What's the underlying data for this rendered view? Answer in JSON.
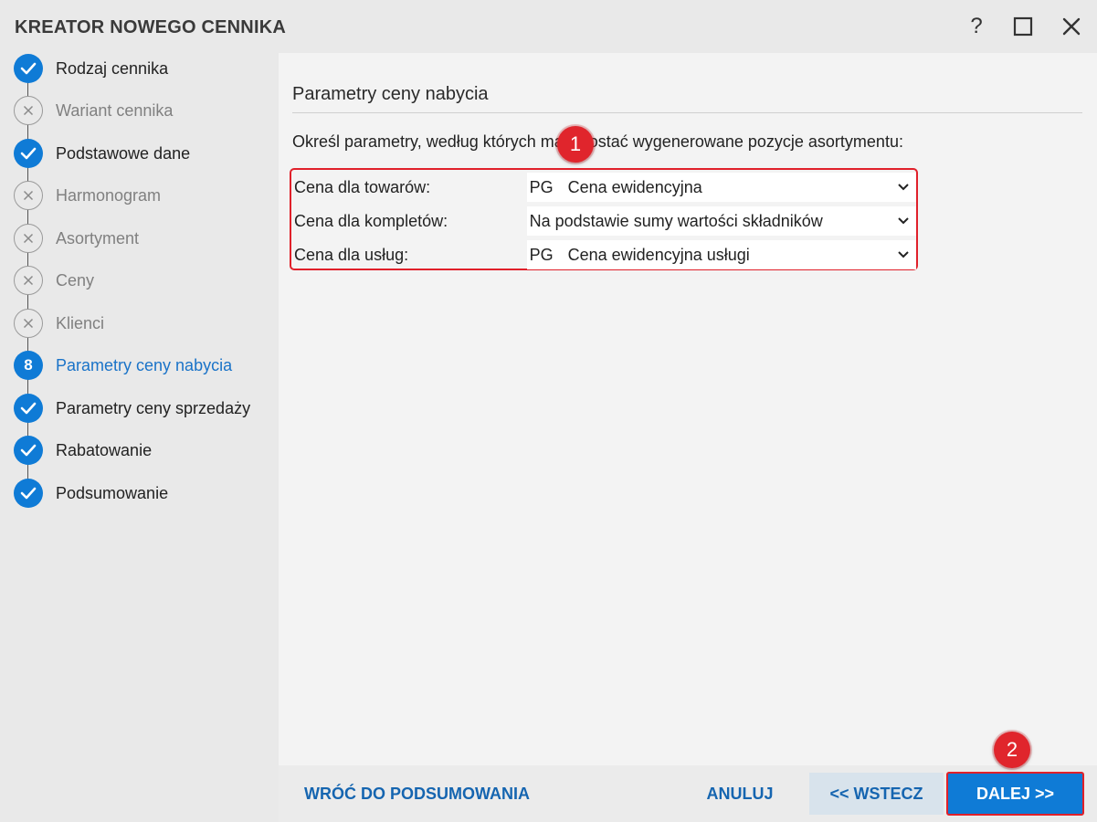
{
  "window": {
    "title": "KREATOR NOWEGO CENNIKA",
    "help_label": "?"
  },
  "steps": [
    {
      "label": "Rodzaj cennika",
      "state": "done"
    },
    {
      "label": "Wariant cennika",
      "state": "skipped"
    },
    {
      "label": "Podstawowe dane",
      "state": "done"
    },
    {
      "label": "Harmonogram",
      "state": "skipped"
    },
    {
      "label": "Asortyment",
      "state": "skipped"
    },
    {
      "label": "Ceny",
      "state": "skipped"
    },
    {
      "label": "Klienci",
      "state": "skipped"
    },
    {
      "label": "Parametry ceny nabycia",
      "state": "current",
      "number": "8"
    },
    {
      "label": "Parametry ceny sprzedaży",
      "state": "done"
    },
    {
      "label": "Rabatowanie",
      "state": "done"
    },
    {
      "label": "Podsumowanie",
      "state": "done"
    }
  ],
  "content": {
    "section_title": "Parametry ceny nabycia",
    "description": "Określ parametry, według których mają zostać wygenerowane pozycje asortymentu:",
    "params": [
      {
        "label": "Cena dla towarów:",
        "code": "PG",
        "value": "Cena ewidencyjna"
      },
      {
        "label": "Cena dla kompletów:",
        "code": "",
        "value": "Na podstawie sumy wartości składników"
      },
      {
        "label": "Cena dla usług:",
        "code": "PG",
        "value": "Cena ewidencyjna usługi"
      }
    ]
  },
  "annotations": {
    "badge1": "1",
    "badge2": "2"
  },
  "footer": {
    "summary_label": "WRÓĆ DO PODSUMOWANIA",
    "cancel_label": "ANULUJ",
    "back_label": "<< WSTECZ",
    "next_label": "DALEJ >>"
  },
  "colors": {
    "accent": "#0f7bd6",
    "highlight": "#e0202a",
    "background": "#e9e9e9"
  }
}
